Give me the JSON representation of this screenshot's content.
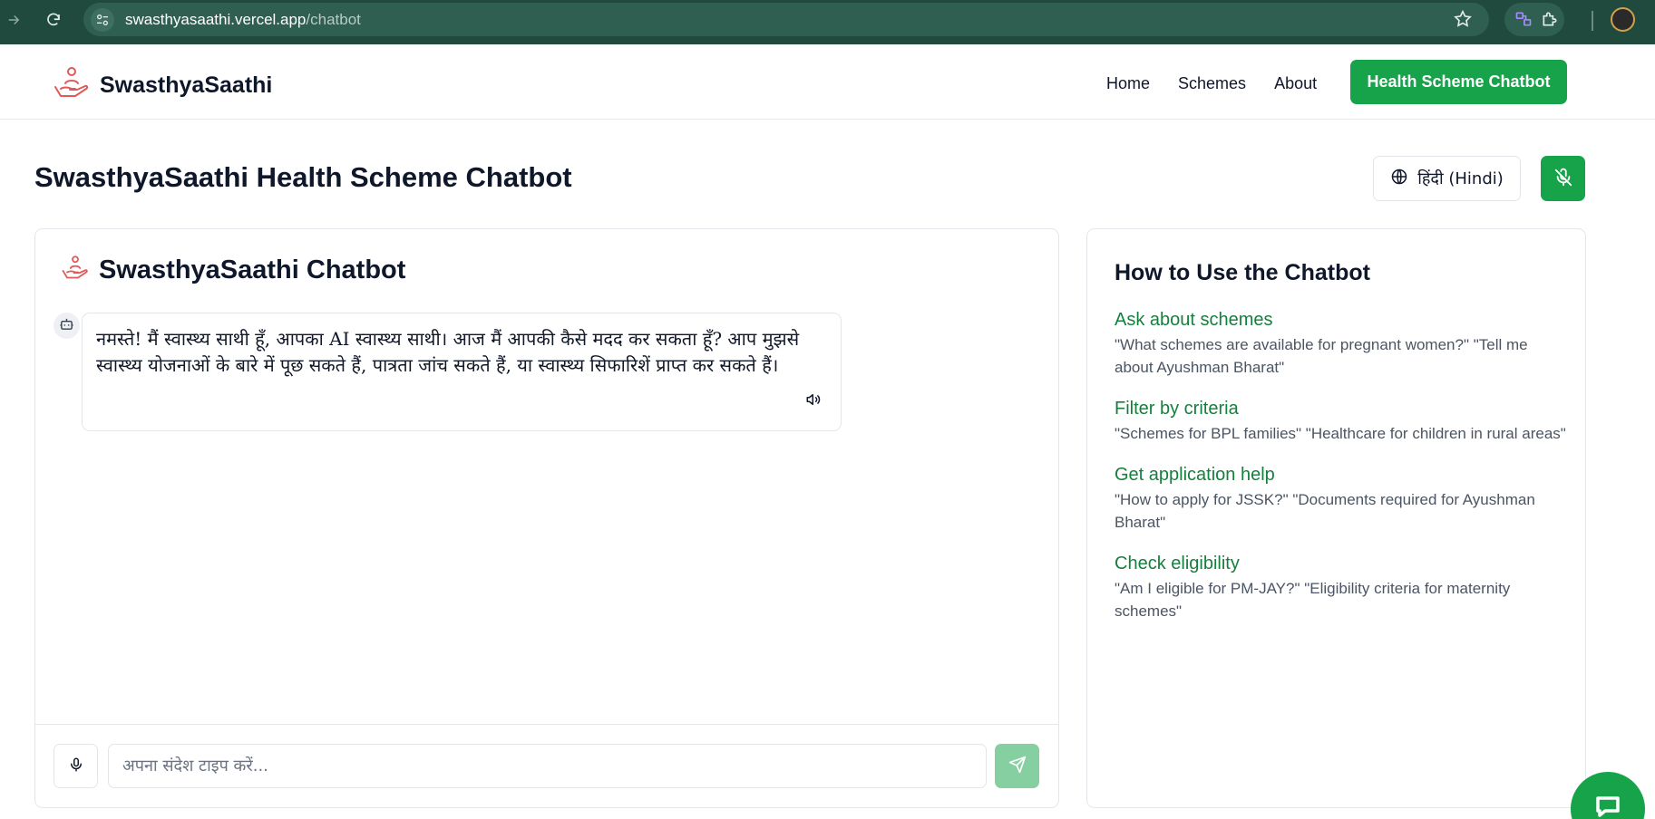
{
  "browser": {
    "url_host": "swasthyasaathi.vercel.app",
    "url_path": "/chatbot"
  },
  "header": {
    "brand": "SwasthyaSaathi",
    "nav": [
      "Home",
      "Schemes",
      "About"
    ],
    "cta": "Health Scheme Chatbot"
  },
  "page": {
    "title": "SwasthyaSaathi Health Scheme Chatbot",
    "language_button": "हिंदी (Hindi)"
  },
  "chat": {
    "title": "SwasthyaSaathi Chatbot",
    "messages": [
      {
        "sender": "bot",
        "text": "नमस्ते! मैं स्वास्थ्य साथी हूँ, आपका AI स्वास्थ्य साथी। आज मैं आपकी कैसे मदद कर सकता हूँ? आप मुझसे स्वास्थ्य योजनाओं के बारे में पूछ सकते हैं, पात्रता जांच सकते हैं, या स्वास्थ्य सिफारिशें प्राप्त कर सकते हैं।"
      }
    ],
    "input_placeholder": "अपना संदेश टाइप करें...",
    "input_value": ""
  },
  "help": {
    "title": "How to Use the Chatbot",
    "items": [
      {
        "title": "Ask about schemes",
        "desc": "\"What schemes are available for pregnant women?\" \"Tell me about Ayushman Bharat\""
      },
      {
        "title": "Filter by criteria",
        "desc": "\"Schemes for BPL families\" \"Healthcare for children in rural areas\""
      },
      {
        "title": "Get application help",
        "desc": "\"How to apply for JSSK?\" \"Documents required for Ayushman Bharat\""
      },
      {
        "title": "Check eligibility",
        "desc": "\"Am I eligible for PM-JAY?\" \"Eligibility criteria for maternity schemes\""
      }
    ]
  },
  "colors": {
    "primary": "#16a34a",
    "primary_light": "#86cfa1",
    "link_green": "#15803d",
    "browser_bar": "#1f4a3d",
    "logo_red": "#e05a5a"
  }
}
